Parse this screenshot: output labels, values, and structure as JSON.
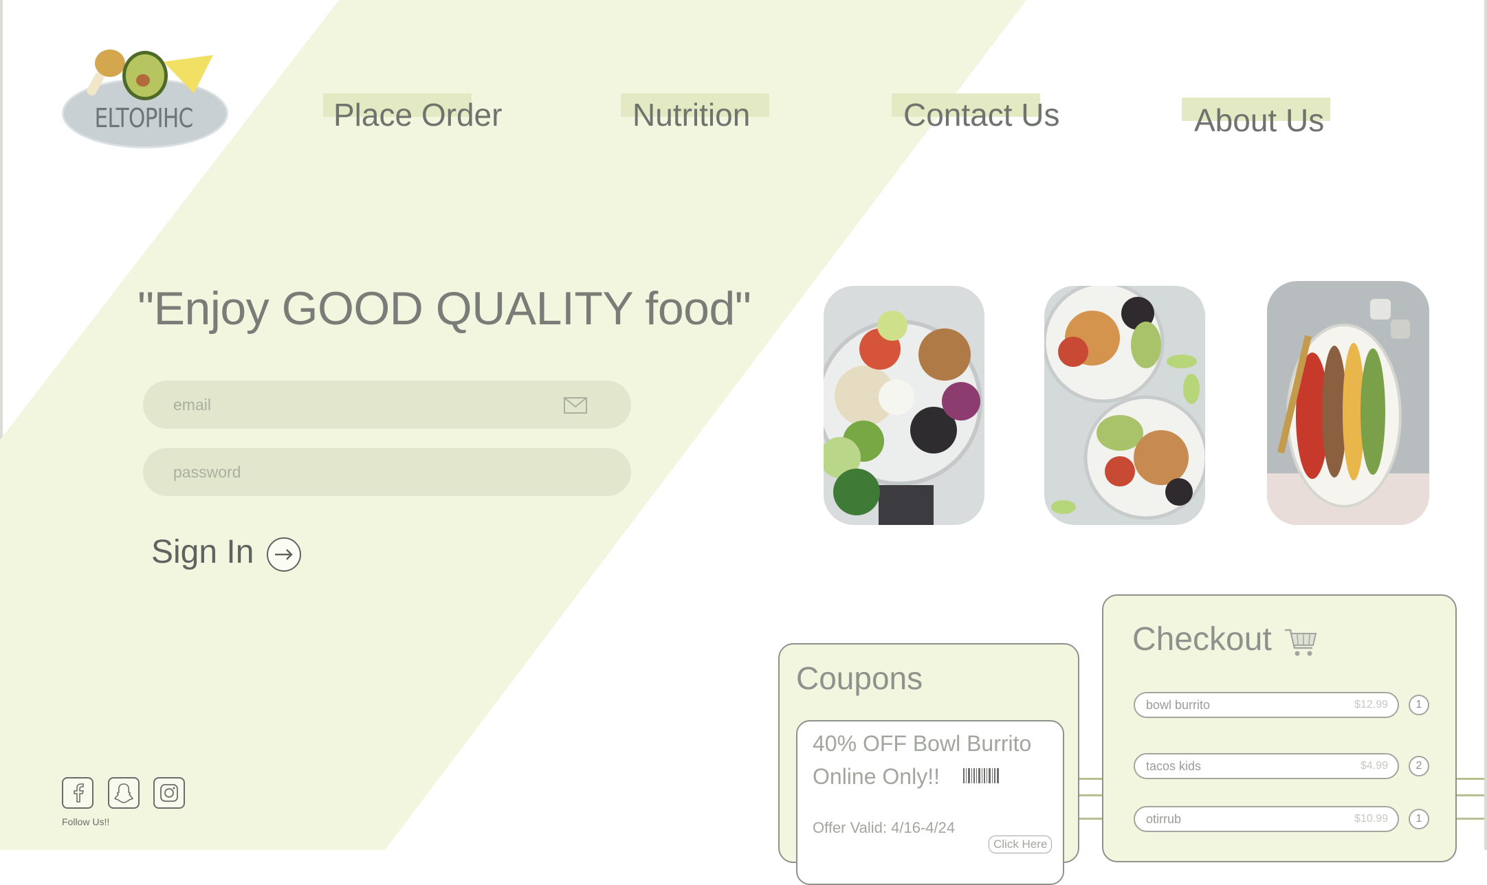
{
  "brand": {
    "logo_text": "ELTOPIHC"
  },
  "nav": [
    {
      "label": "Place Order"
    },
    {
      "label": "Nutrition"
    },
    {
      "label": "Contact Us"
    },
    {
      "label": "About Us"
    }
  ],
  "hero": {
    "tagline": "\"Enjoy GOOD QUALITY food\"",
    "email_placeholder": "email",
    "password_placeholder": "password",
    "signin_label": "Sign In"
  },
  "social": {
    "follow_text": "Follow Us!!",
    "icons": [
      "facebook-icon",
      "snapchat-icon",
      "instagram-icon"
    ]
  },
  "coupons": {
    "title": "Coupons",
    "line1": "40% OFF Bowl Burrito",
    "line2": "Online Only!!",
    "valid": "Offer Valid: 4/16-4/24",
    "button": "Click Here"
  },
  "checkout": {
    "title": "Checkout",
    "items": [
      {
        "name": "bowl burrito",
        "price": "$12.99",
        "qty": "1"
      },
      {
        "name": "tacos kids",
        "price": "$4.99",
        "qty": "2"
      },
      {
        "name": "otirrub",
        "price": "$10.99",
        "qty": "1"
      }
    ]
  },
  "colors": {
    "background": "#ffffff",
    "accent_band": "#f3f6df",
    "nav_highlight": "#e3e9c2",
    "field_fill": "#e1e6cc",
    "text": "#7d7d78"
  }
}
